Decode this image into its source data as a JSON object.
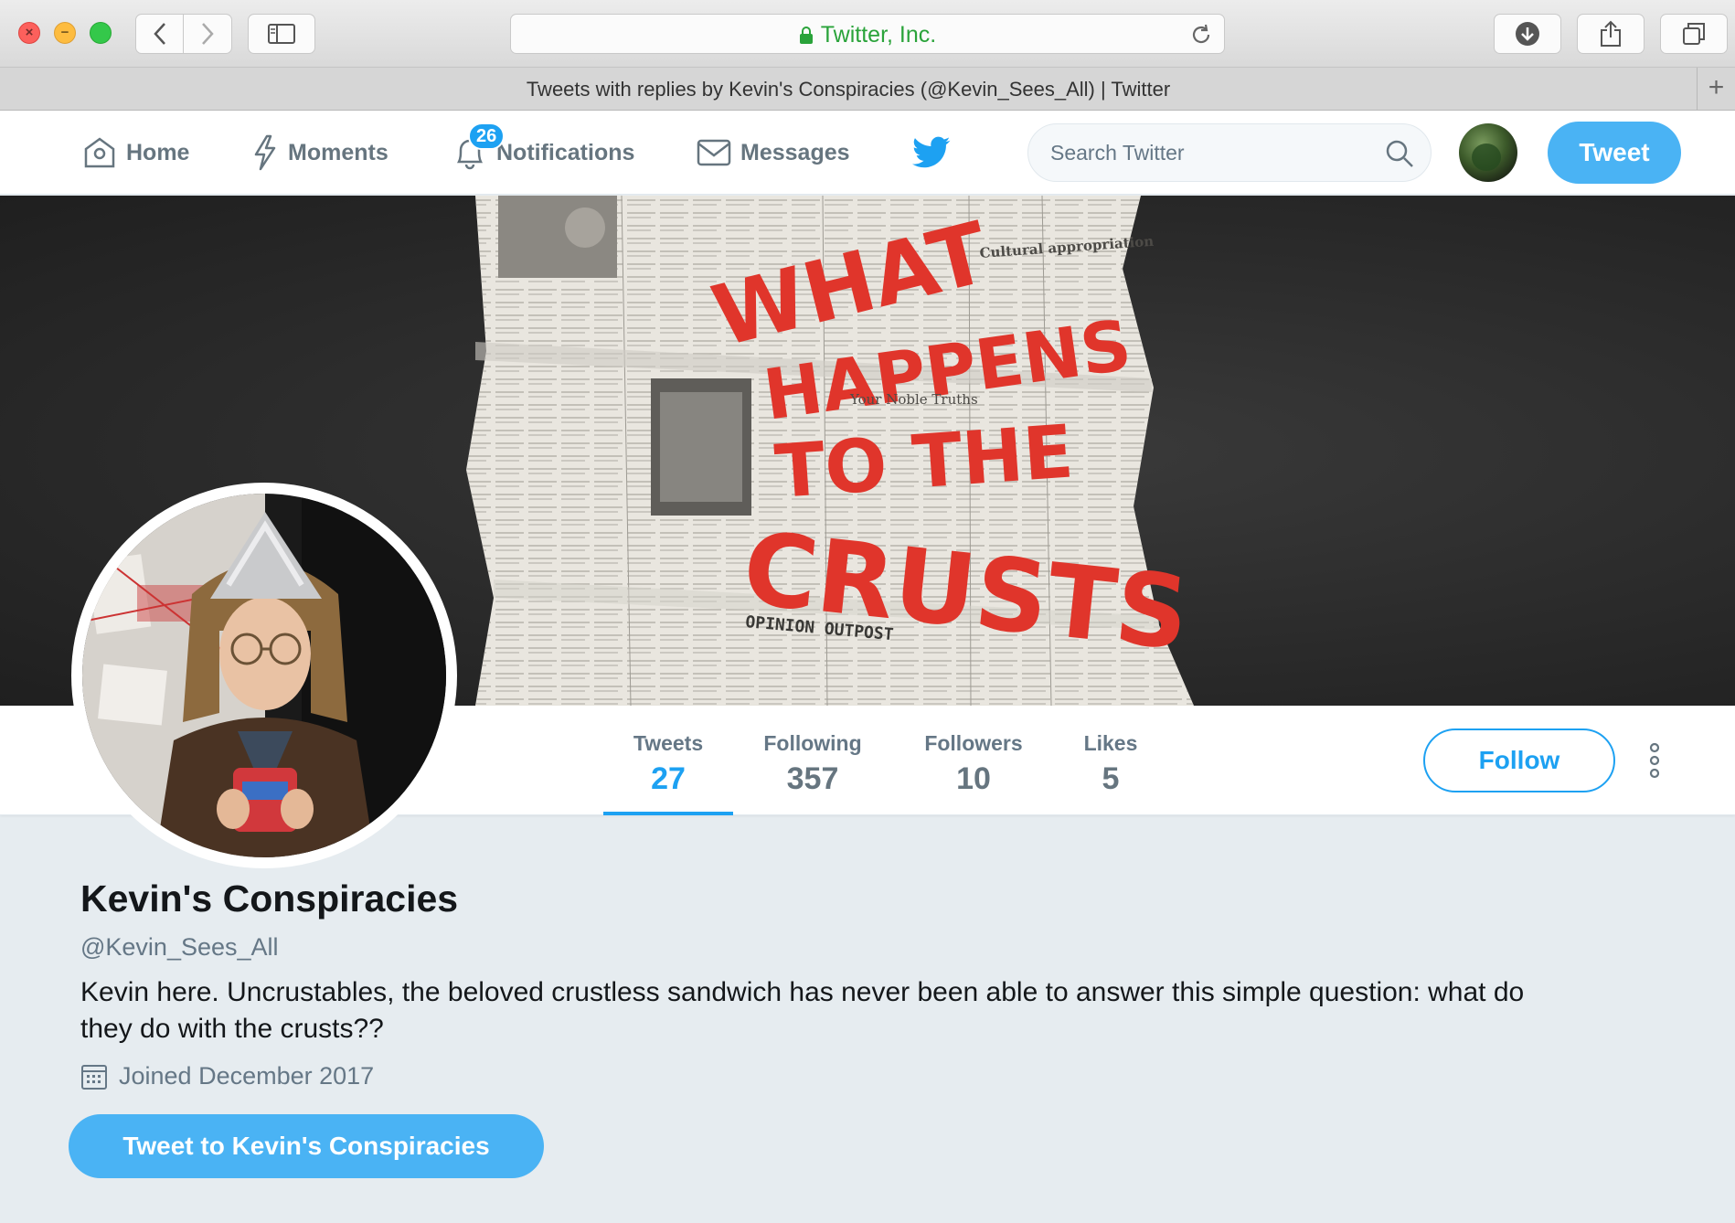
{
  "browser": {
    "url_display": "Twitter, Inc.",
    "tab_title": "Tweets with replies by Kevin's Conspiracies (@Kevin_Sees_All) | Twitter",
    "new_tab_symbol": "+"
  },
  "nav": {
    "home_label": "Home",
    "moments_label": "Moments",
    "notifications_label": "Notifications",
    "notifications_count": "26",
    "messages_label": "Messages",
    "search_placeholder": "Search Twitter",
    "tweet_button_label": "Tweet"
  },
  "banner": {
    "headline_line1": "WHAT",
    "headline_line2": "HAPPENS",
    "headline_line3": "TO THE",
    "headline_line4": "CRUSTS",
    "caption": "OPINION OUTPOST",
    "paper_heading_1": "Cultural appropriation",
    "paper_heading_2": "Your Noble Truths"
  },
  "stats": {
    "tweets_label": "Tweets",
    "tweets_value": "27",
    "following_label": "Following",
    "following_value": "357",
    "followers_label": "Followers",
    "followers_value": "10",
    "likes_label": "Likes",
    "likes_value": "5"
  },
  "actions": {
    "follow_label": "Follow",
    "tweet_to_label": "Tweet to Kevin's Conspiracies"
  },
  "profile": {
    "name": "Kevin's Conspiracies",
    "handle": "@Kevin_Sees_All",
    "bio": "Kevin here. Uncrustables, the beloved crustless sandwich has never been able to answer this simple question: what do they do with the crusts??",
    "joined": "Joined December 2017"
  },
  "colors": {
    "twitter_blue": "#1da1f2",
    "button_blue": "#4ab3f4",
    "page_bg": "#e6ecf0",
    "text_muted": "#657786",
    "headline_red": "#e0352b",
    "url_green": "#2aa33a"
  },
  "icons": {
    "home": "home-icon",
    "moments": "lightning-icon",
    "notifications": "bell-icon",
    "messages": "envelope-icon",
    "logo": "twitter-bird-icon",
    "search": "search-icon",
    "joined": "calendar-icon",
    "more": "vertical-dots-icon"
  }
}
